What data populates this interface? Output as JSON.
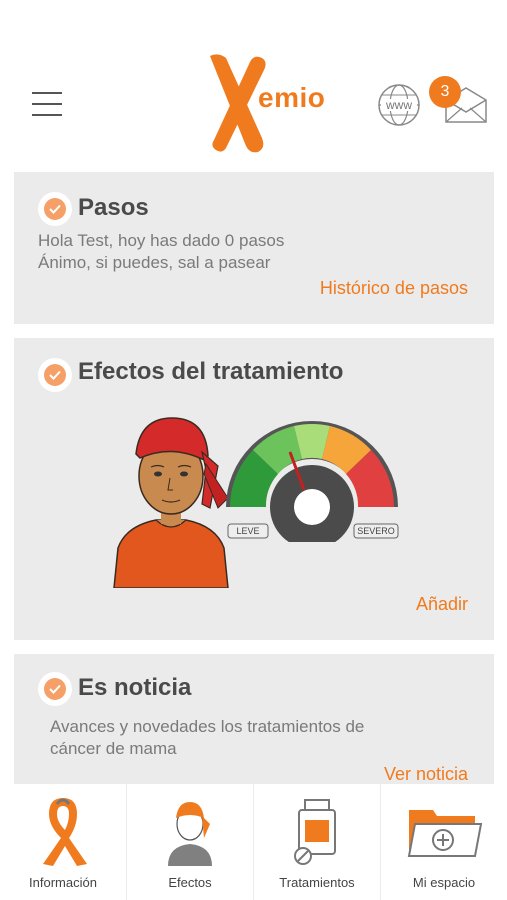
{
  "header": {
    "logo_text": "emio",
    "www_label": "www",
    "notification_count": "3"
  },
  "cards": {
    "pasos": {
      "title": "Pasos",
      "line1": "Hola Test, hoy has dado 0 pasos",
      "line2": "Ánimo, si puedes, sal a pasear",
      "link": "Histórico de pasos"
    },
    "efectos": {
      "title": "Efectos del tratamiento",
      "gauge_left": "LEVE",
      "gauge_right": "SEVERO",
      "link": "Añadir"
    },
    "noticia": {
      "title": "Es noticia",
      "line1": "Avances y novedades los tratamientos de",
      "line2": "cáncer de mama",
      "link": "Ver noticia"
    }
  },
  "tabs": [
    {
      "label": "Información",
      "icon": "ribbon-icon"
    },
    {
      "label": "Efectos",
      "icon": "person-icon"
    },
    {
      "label": "Tratamientos",
      "icon": "medicine-bottle-icon"
    },
    {
      "label": "Mi espacio",
      "icon": "folder-add-icon"
    }
  ],
  "colors": {
    "accent": "#f07b1f",
    "card_bg": "#ebebeb",
    "text": "#4a4a4a"
  }
}
